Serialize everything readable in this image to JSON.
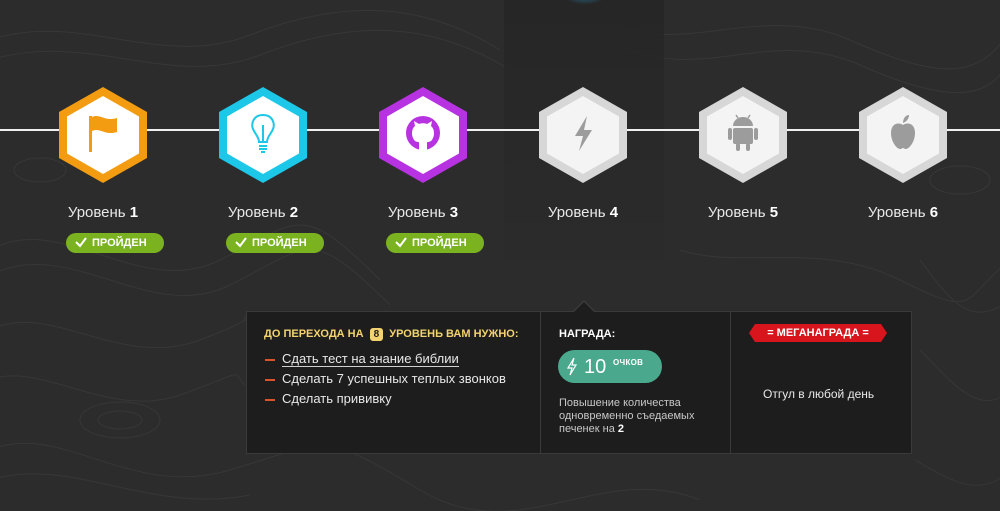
{
  "levels": [
    {
      "name": "Уровень",
      "number": "1",
      "status": "ПРОЙДЕН",
      "icon": "flag-icon",
      "color": "#f39c12",
      "completed": true
    },
    {
      "name": "Уровень",
      "number": "2",
      "status": "ПРОЙДЕН",
      "icon": "lightbulb-icon",
      "color": "#1cc7e8",
      "completed": true
    },
    {
      "name": "Уровень",
      "number": "3",
      "status": "ПРОЙДЕН",
      "icon": "github-icon",
      "color": "#b732e0",
      "completed": true
    },
    {
      "name": "Уровень",
      "number": "4",
      "status": "",
      "icon": "lightning-icon",
      "color": "#cfcfcf",
      "completed": false
    },
    {
      "name": "Уровень",
      "number": "5",
      "status": "",
      "icon": "android-icon",
      "color": "#cfcfcf",
      "completed": false
    },
    {
      "name": "Уровень",
      "number": "6",
      "status": "",
      "icon": "apple-icon",
      "color": "#cfcfcf",
      "completed": false
    }
  ],
  "panel": {
    "requirements": {
      "title_before": "ДО ПЕРЕХОДА НА",
      "title_level": "8",
      "title_after": "УРОВЕНЬ ВАМ НУЖНО:",
      "items": [
        "Сдать тест на знание библии",
        "Сделать 7 успешных теплых звонков",
        "Сделать прививку"
      ]
    },
    "reward": {
      "title": "НАГРАДА:",
      "points_value": "10",
      "points_unit": "ОЧКОВ",
      "description": "Повышение количества одновременно съедаемых печенек на",
      "description_value": "2"
    },
    "mega": {
      "title": "= МЕГАНАГРАДА =",
      "text": "Отгул в любой день"
    }
  },
  "colors": {
    "background": "#2c2c2c",
    "completed_badge": "#7bb21f",
    "points_pill": "#4aa98d",
    "mega_badge": "#d8141c",
    "requirements_title": "#f3d36e",
    "bullet": "#d9532b"
  }
}
